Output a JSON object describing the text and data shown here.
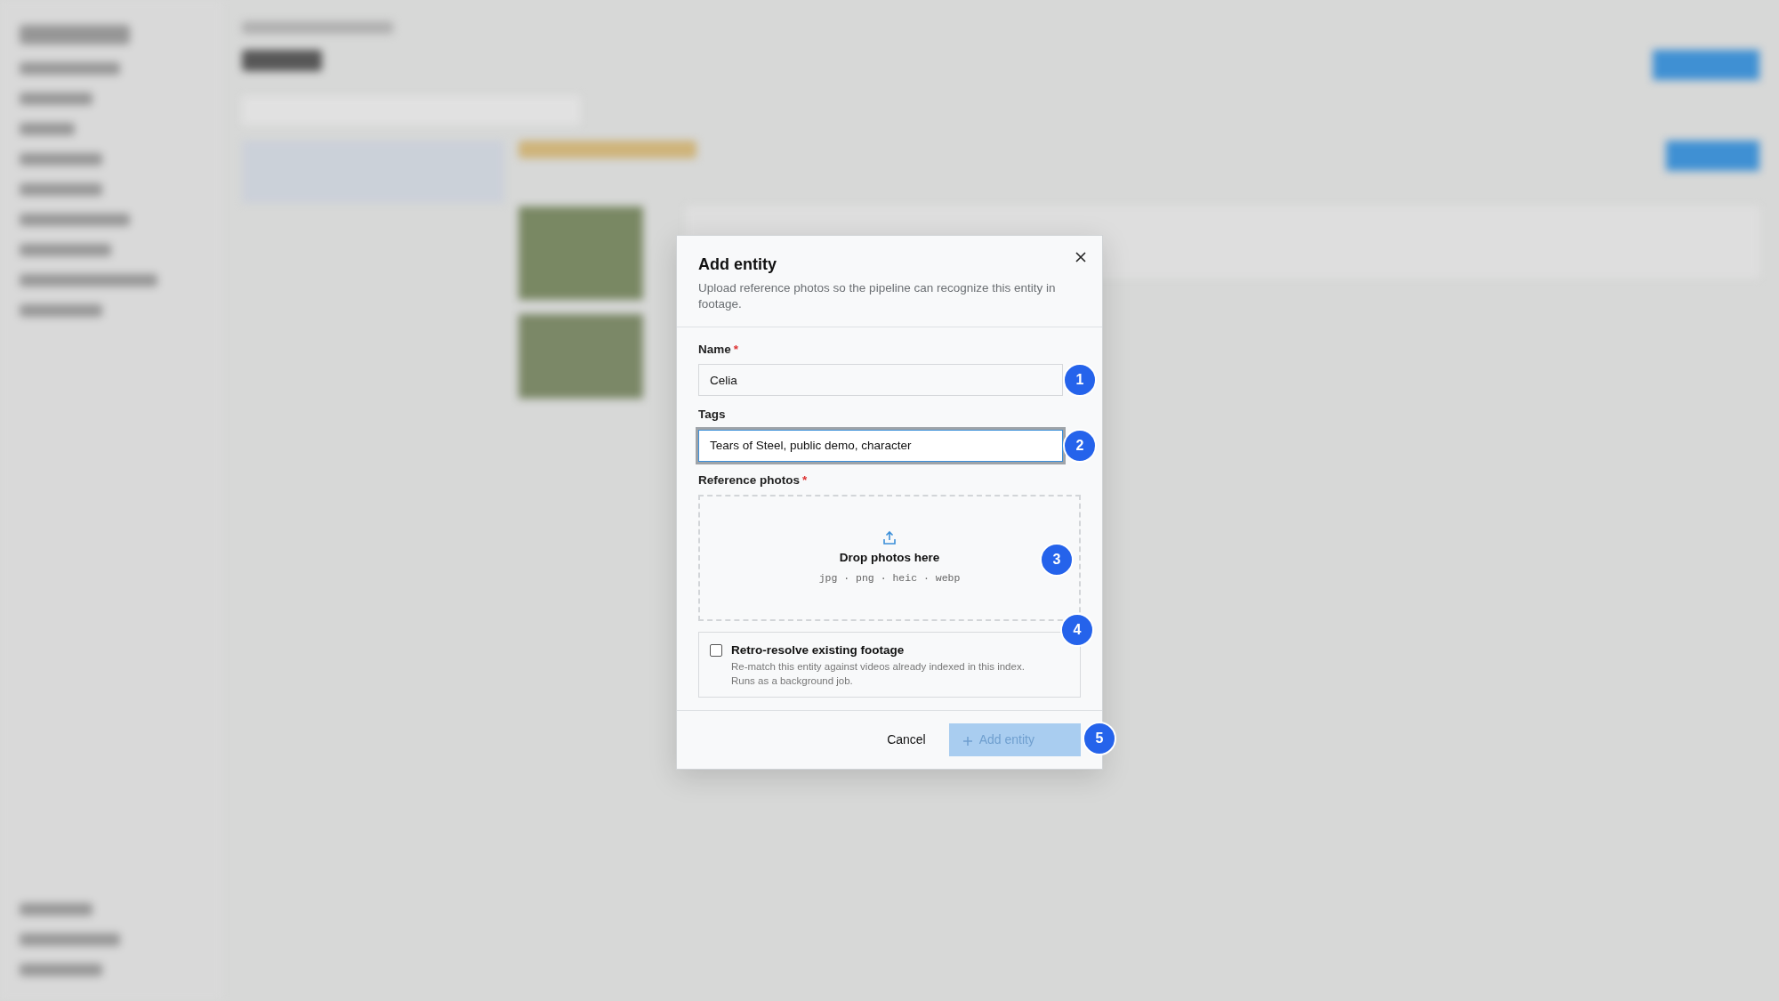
{
  "dialog": {
    "title": "Add entity",
    "subtitle": "Upload reference photos so the pipeline can recognize this entity in footage.",
    "fields": [
      {
        "kind": "text",
        "label": "Name",
        "required_mark": "*",
        "value": "Celia",
        "focused": false,
        "marker": "1"
      },
      {
        "kind": "text",
        "label": "Tags",
        "value": "Tears of Steel, public demo, character",
        "focused": true,
        "marker": "2"
      },
      {
        "kind": "dropzone",
        "label": "Reference photos",
        "required_mark": "*",
        "prompt": "Drop photos here",
        "formats": "jpg · png · heic · webp",
        "marker": "3"
      },
      {
        "kind": "checkbox",
        "label": "Retro-resolve existing footage",
        "description": "Re-match this entity against videos already indexed in this index. Runs as a background job.",
        "checked": false,
        "marker": "4"
      }
    ],
    "buttons": [
      {
        "kind": "secondary",
        "label": "Cancel",
        "disabled": false
      },
      {
        "kind": "primary",
        "label": "Add entity",
        "disabled": true,
        "marker": "5"
      }
    ]
  }
}
